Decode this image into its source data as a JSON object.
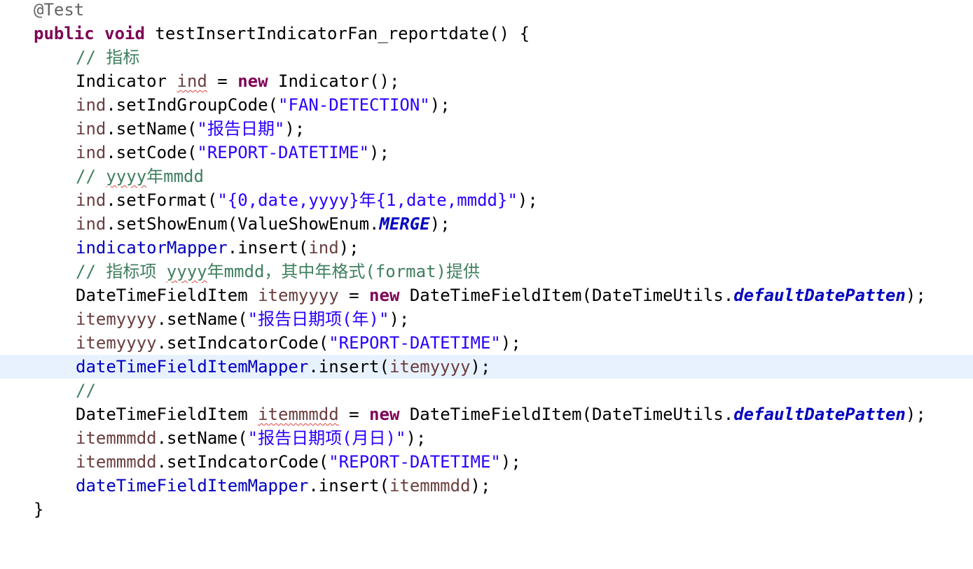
{
  "editor": {
    "language": "java",
    "colors": {
      "background": "#ffffff",
      "current_line_highlight": "#e8f2fe",
      "keyword": "#7f0055",
      "comment": "#3f7f5f",
      "string": "#2a00ff",
      "annotation": "#646464",
      "field": "#0000c0",
      "local_variable": "#6a3e3e"
    },
    "current_line": 15,
    "lines": [
      [
        "@Test"
      ],
      [
        "public",
        " ",
        "void",
        " testInsertIndicatorFan_reportdate() {"
      ],
      [
        "// 指标"
      ],
      [
        "Indicator ",
        "ind",
        " = ",
        "new",
        " Indicator();"
      ],
      [
        "ind",
        ".setIndGroupCode(",
        "\"FAN-DETECTION\"",
        ");"
      ],
      [
        "ind",
        ".setName(",
        "\"报告日期\"",
        ");"
      ],
      [
        "ind",
        ".setCode(",
        "\"REPORT-DATETIME\"",
        ");"
      ],
      [
        "// ",
        "yyyy",
        "年mmdd"
      ],
      [
        "ind",
        ".setFormat(",
        "\"{0,date,yyyy}年{1,date,mmdd}\"",
        ");"
      ],
      [
        "ind",
        ".setShowEnum(ValueShowEnum.",
        "MERGE",
        ");"
      ],
      [
        "indicatorMapper",
        ".insert(",
        "ind",
        ");"
      ],
      [
        "// 指标项 ",
        "yyyy",
        "年mmdd，其中年格式(format)提供"
      ],
      [
        "DateTimeFieldItem ",
        "itemyyyy",
        " = ",
        "new",
        " DateTimeFieldItem(DateTimeUtils.",
        "defaultDatePatten",
        ");"
      ],
      [
        "itemyyyy",
        ".setName(",
        "\"报告日期项(年)\"",
        ");"
      ],
      [
        "itemyyyy",
        ".setIndcatorCode(",
        "\"REPORT-DATETIME\"",
        ");"
      ],
      [
        "dateTimeFieldItemMapper",
        ".insert(",
        "itemyyyy",
        ");"
      ],
      [
        "//"
      ],
      [
        "DateTimeFieldItem ",
        "itemmmdd",
        " = ",
        "new",
        " DateTimeFieldItem(DateTimeUtils.",
        "defaultDatePatten",
        ");"
      ],
      [
        "itemmmdd",
        ".setName(",
        "\"报告日期项(月日)\"",
        ");"
      ],
      [
        "itemmmdd",
        ".setIndcatorCode(",
        "\"REPORT-DATETIME\"",
        ");"
      ],
      [
        "dateTimeFieldItemMapper",
        ".insert(",
        "itemmmdd",
        ");"
      ],
      [
        "}"
      ]
    ]
  }
}
